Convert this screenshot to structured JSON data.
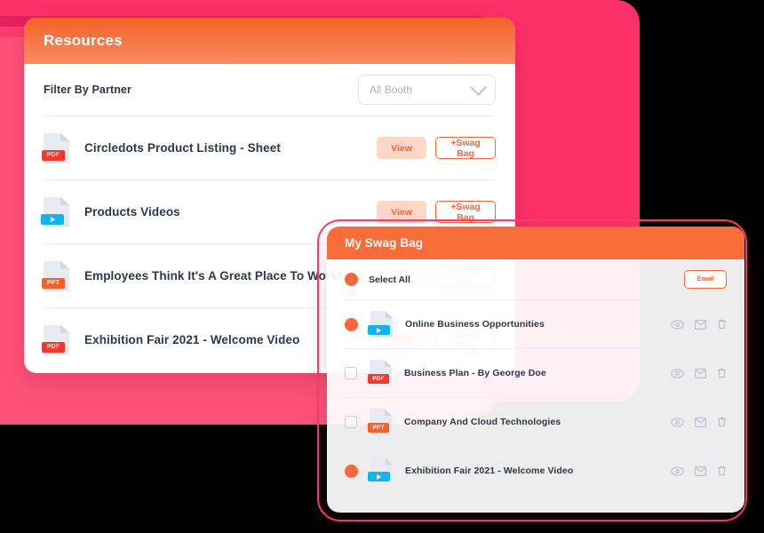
{
  "resources_card": {
    "header": {
      "title": "Resources"
    },
    "filter": {
      "label": "Filter By Partner",
      "select_value": "All Booth",
      "chevron_icon": "chevron-down-icon"
    },
    "action_labels": {
      "view": "View",
      "add_swag": "+Swag Bag"
    },
    "rows": [
      {
        "name": "Circledots Product Listing - Sheet",
        "file_type": "PDF",
        "icon": "pdf-file-icon",
        "view": "View",
        "add_swag": "+Swag Bag"
      },
      {
        "name": "Products Videos",
        "file_type": "VIDEO",
        "icon": "video-file-icon",
        "view": "View",
        "add_swag": "+Swag Bag"
      },
      {
        "name": "Employees Think It's A Great Place To Work!",
        "file_type": "PPT",
        "icon": "ppt-file-icon",
        "view": "View",
        "add_swag": "+Swag Bag"
      },
      {
        "name": "Exhibition Fair 2021 - Welcome Video",
        "file_type": "PDF",
        "icon": "pdf-file-icon",
        "view": "View",
        "add_swag": "+Swag Bag"
      }
    ]
  },
  "swag_card": {
    "header": {
      "title": "My Swag Bag"
    },
    "toolbar": {
      "select_all_label": "Select All",
      "select_all_checked": true,
      "email_button": "Email"
    },
    "rows": [
      {
        "name": "Online Business Opportunities",
        "file_type": "VIDEO",
        "icon": "video-file-icon",
        "selected": true
      },
      {
        "name": "Business Plan - By George Doe",
        "file_type": "PDF",
        "icon": "pdf-file-icon",
        "selected": false
      },
      {
        "name": "Company And Cloud Technologies",
        "file_type": "PPT",
        "icon": "ppt-file-icon",
        "selected": false
      },
      {
        "name": "Exhibition Fair 2021 - Welcome Video",
        "file_type": "VIDEO",
        "icon": "video-file-icon",
        "selected": true
      }
    ],
    "row_action_icons": [
      "eye-icon",
      "envelope-icon",
      "trash-icon"
    ]
  },
  "badges": {
    "pdf": "PDF",
    "ppt": "PPT"
  },
  "colors": {
    "orange": "#f4622a",
    "orange_light": "#fa8b60",
    "orange_solid": "#f76c38",
    "accent_text": "#f8663a",
    "pink": "#fb3167",
    "pink_mid": "#fb3b6e",
    "pink_light": "#fc5277",
    "pink_dark": "#e3215e",
    "pdf_badge": "#f1392f",
    "ppt_badge": "#f4622a",
    "video_badge": "#14b4ef",
    "text": "#2e3648"
  }
}
